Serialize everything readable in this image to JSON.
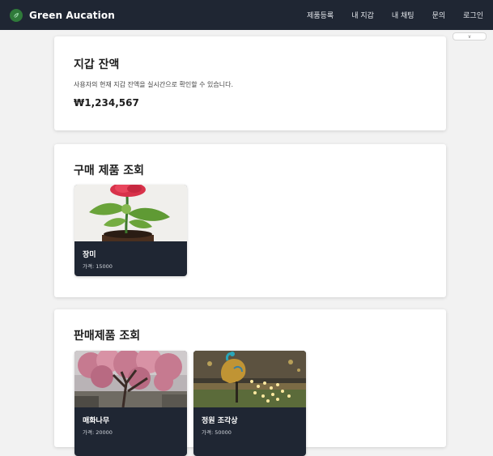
{
  "navbar": {
    "brand": "Green Aucation",
    "links": [
      "제품등록",
      "내 지갑",
      "내 채팅",
      "문의",
      "로그인"
    ]
  },
  "dropdown_tab": {
    "label": "∨"
  },
  "wallet": {
    "title": "지갑 잔액",
    "description": "사용자의 현재 지갑 잔액을 실시간으로 확인할 수 있습니다.",
    "balance": "₩1,234,567"
  },
  "purchased": {
    "title": "구매 제품 조회",
    "items": [
      {
        "name": "장미",
        "price": "가격: 15000",
        "image_icon": "rose-image"
      }
    ]
  },
  "sold": {
    "title": "판매제품 조회",
    "items": [
      {
        "name": "매화나무",
        "price": "가격: 20000",
        "image_icon": "plum-tree-image"
      },
      {
        "name": "정원 조각상",
        "price": "가격: 50000",
        "image_icon": "garden-statue-image"
      }
    ]
  },
  "colors": {
    "navbar_bg": "#1f2633",
    "page_bg": "#f2f2f2",
    "card_bg": "#ffffff",
    "product_card_bg": "#1f2633",
    "logo_green": "#2f7a3a"
  }
}
